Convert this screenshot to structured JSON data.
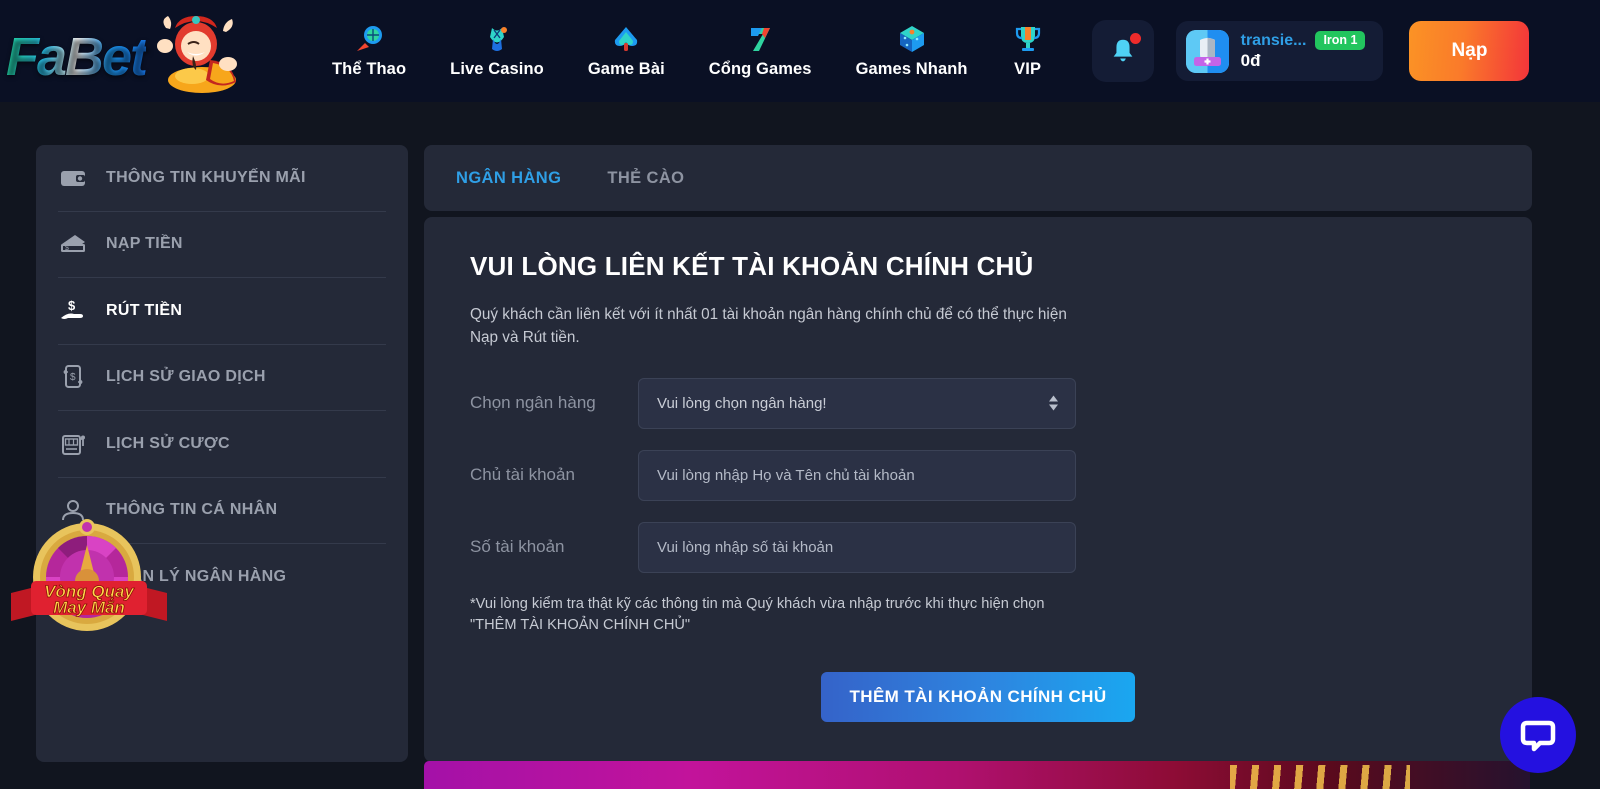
{
  "header": {
    "logo_text": "FaBet",
    "nav": [
      {
        "label": "Thể Thao",
        "icon": "rocket-ball-icon"
      },
      {
        "label": "Live Casino",
        "icon": "dress-icon"
      },
      {
        "label": "Game Bài",
        "icon": "spade-icon"
      },
      {
        "label": "Cổng Games",
        "icon": "seven-icon"
      },
      {
        "label": "Games Nhanh",
        "icon": "dice-cube-icon"
      },
      {
        "label": "VIP",
        "icon": "trophy-icon"
      }
    ],
    "notification_icon": "bell-icon",
    "avatar_icon": "avatar-shield-icon",
    "user_name": "transie...",
    "rank_badge": "Iron 1",
    "balance": "0đ",
    "deposit_button": "Nạp",
    "accent_blue": "#2f9fe6",
    "badge_green": "#22c55e"
  },
  "sidebar": {
    "items": [
      {
        "label": "THÔNG TIN KHUYẾN MÃI",
        "icon": "wallet-icon",
        "active": false
      },
      {
        "label": "NẠP TIỀN",
        "icon": "money-deposit-icon",
        "active": false
      },
      {
        "label": "RÚT TIỀN",
        "icon": "hand-cash-icon",
        "active": true
      },
      {
        "label": "LỊCH SỬ GIAO DỊCH",
        "icon": "transaction-history-icon",
        "active": false
      },
      {
        "label": "LỊCH SỬ CƯỢC",
        "icon": "slot-machine-icon",
        "active": false
      },
      {
        "label": "THÔNG TIN CÁ NHÂN",
        "icon": "user-profile-icon",
        "active": false
      },
      {
        "label": "QUẢN LÝ NGÂN HÀNG",
        "icon": "bank-icon",
        "active": false
      }
    ]
  },
  "promo_widget": {
    "line1": "Vòng Quay",
    "line2": "May Mắn",
    "icon": "lucky-wheel-icon"
  },
  "main": {
    "tabs": [
      {
        "label": "NGÂN HÀNG",
        "active": true
      },
      {
        "label": "THẺ CÀO",
        "active": false
      }
    ],
    "title": "VUI LÒNG LIÊN KẾT TÀI KHOẢN CHÍNH CHỦ",
    "description": "Quý khách cần liên kết với ít nhất 01 tài khoản ngân hàng chính chủ để có thể thực hiện Nạp và Rút tiền.",
    "fields": [
      {
        "label": "Chọn ngân hàng",
        "type": "select",
        "value": "Vui lòng chọn ngân hàng!",
        "placeholder": "Vui lòng chọn ngân hàng!"
      },
      {
        "label": "Chủ tài khoản",
        "type": "text",
        "value": "",
        "placeholder": "Vui lòng nhập Họ và Tên chủ tài khoản"
      },
      {
        "label": "Số tài khoản",
        "type": "text",
        "value": "",
        "placeholder": "Vui lòng nhập số tài khoản"
      }
    ],
    "note": "*Vui lòng kiểm tra thật kỹ các thông tin mà Quý khách vừa nhập trước khi thực hiện chọn \"THÊM TÀI KHOẢN CHÍNH CHỦ\"",
    "submit_button": "THÊM TÀI KHOẢN CHÍNH CHỦ"
  },
  "chat": {
    "icon": "chat-bubble-icon",
    "color": "#2411e0"
  },
  "colors": {
    "page_bg": "#11151f",
    "header_bg": "#0a1024",
    "card_bg": "#242938",
    "input_bg": "#2b3145"
  }
}
